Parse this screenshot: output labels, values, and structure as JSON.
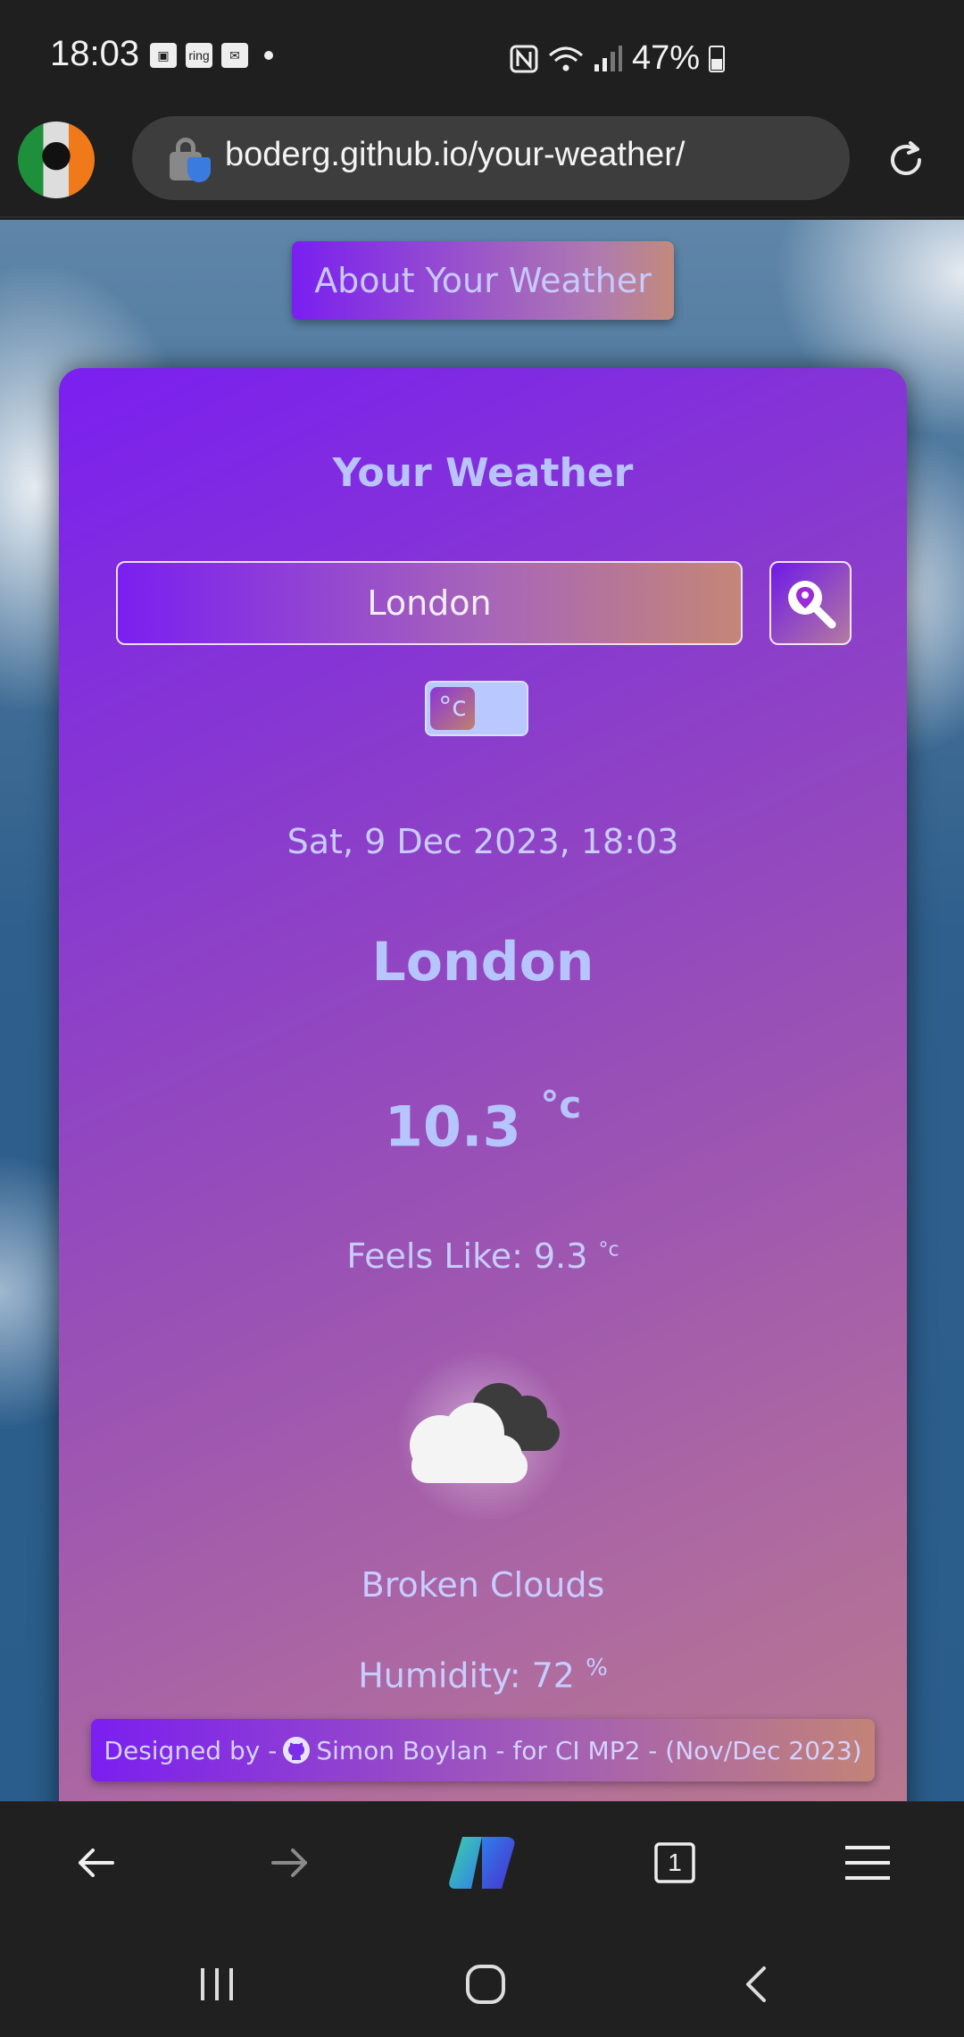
{
  "status_bar": {
    "time": "18:03",
    "left_icons": [
      "gallery-icon",
      "ring-icon",
      "mail-icon",
      "notification-dot-icon"
    ],
    "ring_label": "ring",
    "right_icons": [
      "nfc-icon",
      "wifi-icon",
      "signal-icon",
      "battery-icon"
    ],
    "battery_percent": "47%"
  },
  "browser": {
    "url": "boderg.github.io/your-weather/",
    "bottom_bar": [
      "back-icon",
      "forward-icon",
      "copilot-icon",
      "tabs-icon",
      "menu-icon"
    ],
    "tab_count": "1"
  },
  "page": {
    "about_button": "About Your Weather",
    "title": "Your Weather",
    "search": {
      "value": "London",
      "placeholder": ""
    },
    "unit_toggle": {
      "unit": "°c"
    },
    "date_time": "Sat, 9 Dec 2023, 18:03",
    "city": "London",
    "temperature": "10.3",
    "temperature_unit": "°c",
    "feels_like_label": "Feels Like: 9.3",
    "feels_like_unit": "°c",
    "weather_icon": "broken-clouds-icon",
    "description": "Broken Clouds",
    "humidity_label": "Humidity: 72",
    "humidity_unit": "%",
    "footer": {
      "prefix": "Designed by -",
      "text": "Simon Boylan - for CI MP2 - (Nov/Dec 2023)"
    }
  },
  "colors": {
    "accent_purple": "#7a1ff0",
    "accent_copper": "#c28a7c",
    "text_lavender": "#b7c5ff"
  }
}
